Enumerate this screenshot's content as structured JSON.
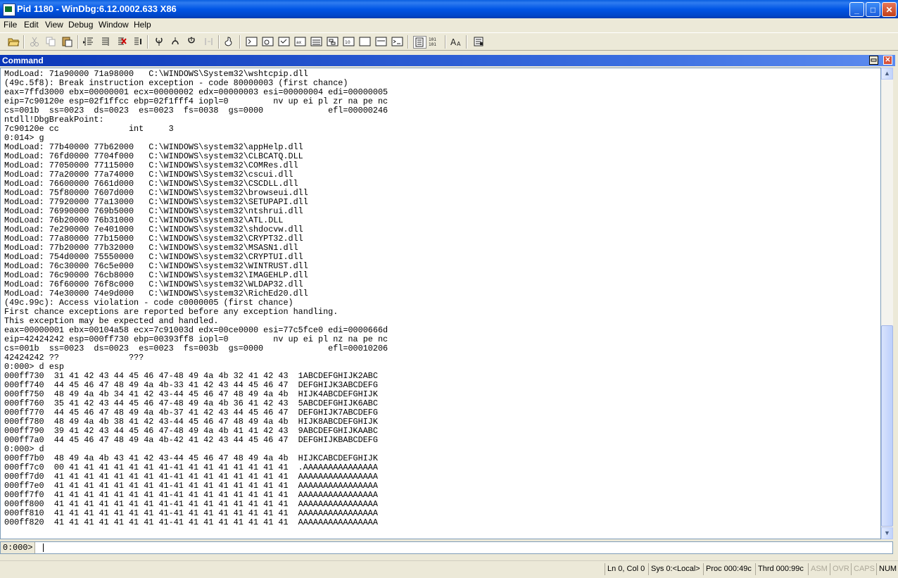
{
  "window": {
    "title": "Pid 1180 - WinDbg:6.12.0002.633 X86",
    "buttons": {
      "minimize": "_",
      "maximize": "□",
      "close": "✕"
    }
  },
  "menu": [
    "File",
    "Edit",
    "View",
    "Debug",
    "Window",
    "Help"
  ],
  "toolbar_icons": [
    "open-icon",
    "cut-icon",
    "copy-icon",
    "paste-icon",
    "go-icon",
    "restart-icon",
    "stop-debugging-icon",
    "break-icon",
    "step-into-icon",
    "step-over-icon",
    "step-out-icon",
    "run-to-cursor-icon",
    "source-mode-icon",
    "command-window-icon",
    "watch-window-icon",
    "locals-window-icon",
    "registers-window-icon",
    "memory-window-icon",
    "call-stack-icon",
    "disassembly-icon",
    "scratch-pad-icon",
    "source-mode-on-icon",
    "source-mode-off-icon",
    "hex-display-icon",
    "font-icon",
    "options-icon"
  ],
  "command_window": {
    "title": "Command",
    "output": "ModLoad: 71a90000 71a98000   C:\\WINDOWS\\System32\\wshtcpip.dll\n(49c.5f8): Break instruction exception - code 80000003 (first chance)\neax=7ffd3000 ebx=00000001 ecx=00000002 edx=00000003 esi=00000004 edi=00000005\neip=7c90120e esp=02f1ffcc ebp=02f1fff4 iopl=0         nv up ei pl zr na pe nc\ncs=001b  ss=0023  ds=0023  es=0023  fs=0038  gs=0000             efl=00000246\nntdll!DbgBreakPoint:\n7c90120e cc              int     3\n0:014> g\nModLoad: 77b40000 77b62000   C:\\WINDOWS\\system32\\appHelp.dll\nModLoad: 76fd0000 7704f000   C:\\WINDOWS\\system32\\CLBCATQ.DLL\nModLoad: 77050000 77115000   C:\\WINDOWS\\system32\\COMRes.dll\nModLoad: 77a20000 77a74000   C:\\WINDOWS\\System32\\cscui.dll\nModLoad: 76600000 7661d000   C:\\WINDOWS\\System32\\CSCDLL.dll\nModLoad: 75f80000 7607d000   C:\\WINDOWS\\system32\\browseui.dll\nModLoad: 77920000 77a13000   C:\\WINDOWS\\system32\\SETUPAPI.dll\nModLoad: 76990000 769b5000   C:\\WINDOWS\\system32\\ntshrui.dll\nModLoad: 76b20000 76b31000   C:\\WINDOWS\\system32\\ATL.DLL\nModLoad: 7e290000 7e401000   C:\\WINDOWS\\system32\\shdocvw.dll\nModLoad: 77a80000 77b15000   C:\\WINDOWS\\system32\\CRYPT32.dll\nModLoad: 77b20000 77b32000   C:\\WINDOWS\\system32\\MSASN1.dll\nModLoad: 754d0000 75550000   C:\\WINDOWS\\system32\\CRYPTUI.dll\nModLoad: 76c30000 76c5e000   C:\\WINDOWS\\system32\\WINTRUST.dll\nModLoad: 76c90000 76cb8000   C:\\WINDOWS\\system32\\IMAGEHLP.dll\nModLoad: 76f60000 76f8c000   C:\\WINDOWS\\system32\\WLDAP32.dll\nModLoad: 74e30000 74e9d000   C:\\WINDOWS\\system32\\RichEd20.dll\n(49c.99c): Access violation - code c0000005 (first chance)\nFirst chance exceptions are reported before any exception handling.\nThis exception may be expected and handled.\neax=00000001 ebx=00104a58 ecx=7c91003d edx=00ce0000 esi=77c5fce0 edi=0000666d\neip=42424242 esp=000ff730 ebp=00393ff8 iopl=0         nv up ei pl nz na pe nc\ncs=001b  ss=0023  ds=0023  es=0023  fs=003b  gs=0000             efl=00010206\n42424242 ??              ???\n0:000> d esp\n000ff730  31 41 42 43 44 45 46 47-48 49 4a 4b 32 41 42 43  1ABCDEFGHIJK2ABC\n000ff740  44 45 46 47 48 49 4a 4b-33 41 42 43 44 45 46 47  DEFGHIJK3ABCDEFG\n000ff750  48 49 4a 4b 34 41 42 43-44 45 46 47 48 49 4a 4b  HIJK4ABCDEFGHIJK\n000ff760  35 41 42 43 44 45 46 47-48 49 4a 4b 36 41 42 43  5ABCDEFGHIJK6ABC\n000ff770  44 45 46 47 48 49 4a 4b-37 41 42 43 44 45 46 47  DEFGHIJK7ABCDEFG\n000ff780  48 49 4a 4b 38 41 42 43-44 45 46 47 48 49 4a 4b  HIJK8ABCDEFGHIJK\n000ff790  39 41 42 43 44 45 46 47-48 49 4a 4b 41 41 42 43  9ABCDEFGHIJKAABC\n000ff7a0  44 45 46 47 48 49 4a 4b-42 41 42 43 44 45 46 47  DEFGHIJKBABCDEFG\n0:000> d\n000ff7b0  48 49 4a 4b 43 41 42 43-44 45 46 47 48 49 4a 4b  HIJKCABCDEFGHIJK\n000ff7c0  00 41 41 41 41 41 41 41-41 41 41 41 41 41 41 41  .AAAAAAAAAAAAAAA\n000ff7d0  41 41 41 41 41 41 41 41-41 41 41 41 41 41 41 41  AAAAAAAAAAAAAAAA\n000ff7e0  41 41 41 41 41 41 41 41-41 41 41 41 41 41 41 41  AAAAAAAAAAAAAAAA\n000ff7f0  41 41 41 41 41 41 41 41-41 41 41 41 41 41 41 41  AAAAAAAAAAAAAAAA\n000ff800  41 41 41 41 41 41 41 41-41 41 41 41 41 41 41 41  AAAAAAAAAAAAAAAA\n000ff810  41 41 41 41 41 41 41 41-41 41 41 41 41 41 41 41  AAAAAAAAAAAAAAAA\n000ff820  41 41 41 41 41 41 41 41-41 41 41 41 41 41 41 41  AAAAAAAAAAAAAAAA",
    "prompt": "0:000>",
    "input_value": ""
  },
  "status": {
    "ln_col": "Ln 0, Col 0",
    "sys": "Sys 0:<Local>",
    "proc": "Proc 000:49c",
    "thrd": "Thrd 000:99c",
    "asm": "ASM",
    "ovr": "OVR",
    "caps": "CAPS",
    "num": "NUM"
  }
}
